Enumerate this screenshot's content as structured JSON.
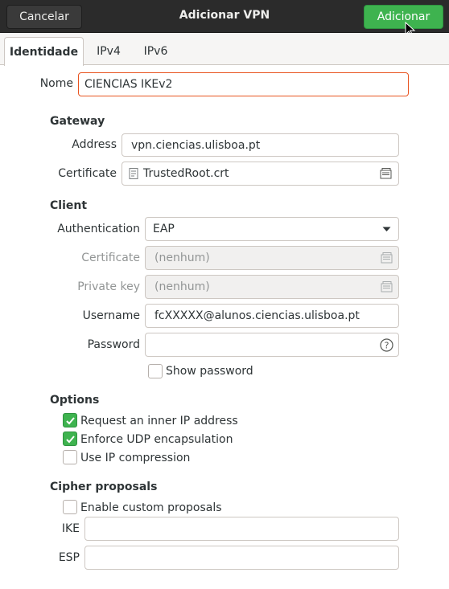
{
  "window": {
    "title": "Adicionar VPN",
    "cancel_label": "Cancelar",
    "add_label": "Adicionar"
  },
  "tabs": [
    {
      "label": "Identidade",
      "active": true
    },
    {
      "label": "IPv4",
      "active": false
    },
    {
      "label": "IPv6",
      "active": false
    }
  ],
  "name": {
    "label": "Nome",
    "value": "CIENCIAS IKEv2"
  },
  "gateway": {
    "title": "Gateway",
    "address_label": "Address",
    "address_value": "vpn.ciencias.ulisboa.pt",
    "certificate_label": "Certificate",
    "certificate_value": "TrustedRoot.crt"
  },
  "client": {
    "title": "Client",
    "auth_label": "Authentication",
    "auth_value": "EAP",
    "certificate_label": "Certificate",
    "certificate_value": "(nenhum)",
    "private_key_label": "Private key",
    "private_key_value": "(nenhum)",
    "username_label": "Username",
    "username_value": "fcXXXXX@alunos.ciencias.ulisboa.pt",
    "password_label": "Password",
    "password_value": "",
    "show_password_label": "Show password",
    "show_password_checked": false
  },
  "options": {
    "title": "Options",
    "items": [
      {
        "label": "Request an inner IP address",
        "checked": true
      },
      {
        "label": "Enforce UDP encapsulation",
        "checked": true
      },
      {
        "label": "Use IP compression",
        "checked": false
      }
    ]
  },
  "cipher": {
    "title": "Cipher proposals",
    "enable_label": "Enable custom proposals",
    "enable_checked": false,
    "ike_label": "IKE",
    "ike_value": "",
    "esp_label": "ESP",
    "esp_value": ""
  },
  "colors": {
    "accent_green": "#3eb34f",
    "focus_orange": "#e95420",
    "header_dark": "#2b2b2b"
  },
  "icons": {
    "file": "file-icon",
    "open": "document-open-icon",
    "dropdown": "chevron-down-icon",
    "help": "help-icon",
    "check": "check-icon",
    "cursor": "mouse-pointer-icon"
  }
}
